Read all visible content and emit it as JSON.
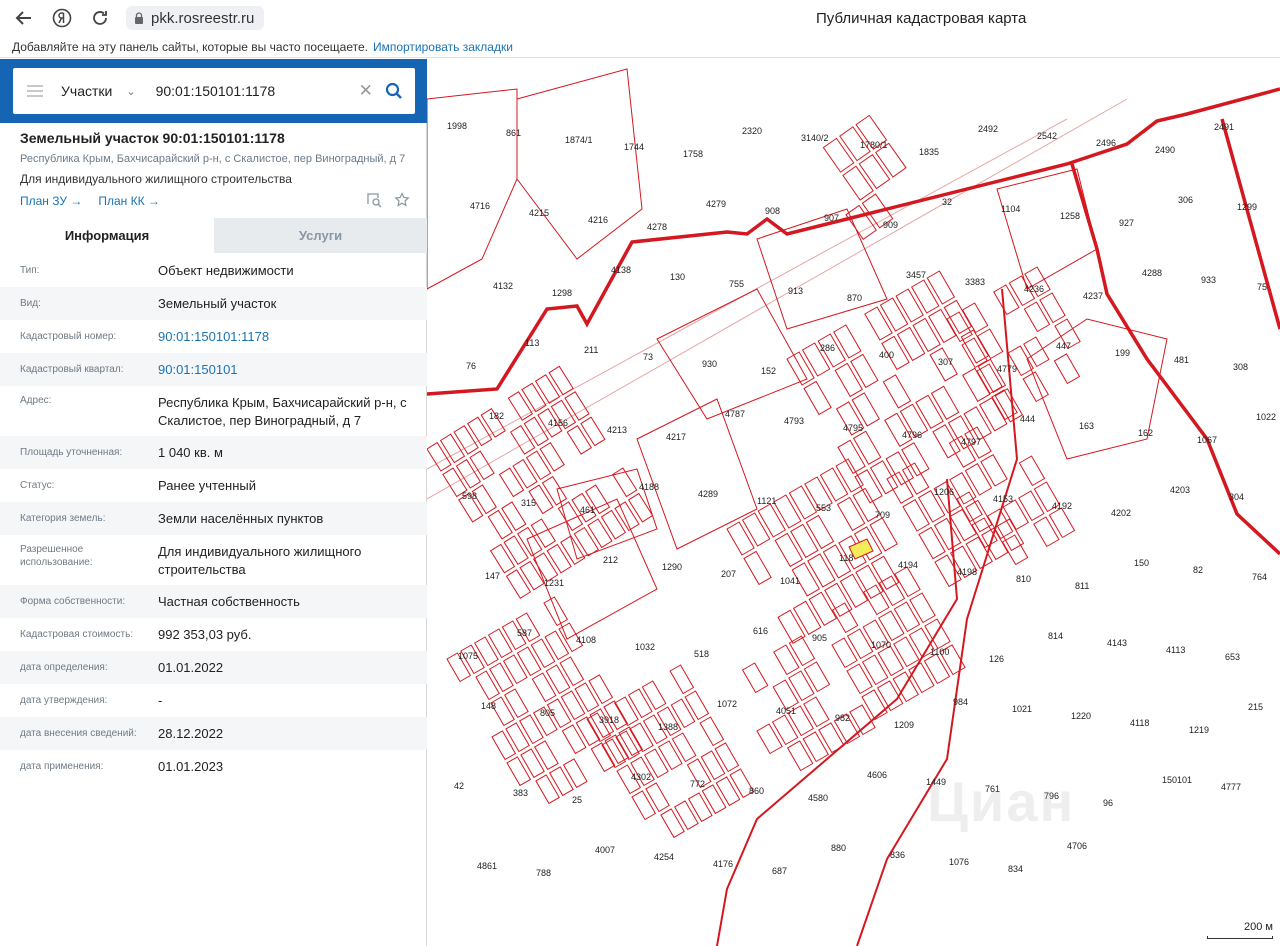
{
  "browser": {
    "url": "pkk.rosreestr.ru",
    "page_title": "Публичная кадастровая карта",
    "bookmarks_text": "Добавляйте на эту панель сайты, которые вы часто посещаете.",
    "import_link": "Импортировать закладки"
  },
  "search": {
    "layer": "Участки",
    "query": "90:01:150101:1178"
  },
  "object": {
    "title": "Земельный участок 90:01:150101:1178",
    "address": "Республика Крым, Бахчисарайский р-н, с Скалистое, пер Виноградный, д 7",
    "use": "Для индивидуального жилищного строительства",
    "plan_zu": "План ЗУ →",
    "plan_kk": "План КК →"
  },
  "tabs": {
    "info": "Информация",
    "services": "Услуги"
  },
  "rows": [
    {
      "key": "Тип:",
      "value": "Объект недвижимости"
    },
    {
      "key": "Вид:",
      "value": "Земельный участок"
    },
    {
      "key": "Кадастровый номер:",
      "value": "90:01:150101:1178"
    },
    {
      "key": "Кадастровый квартал:",
      "value": "90:01:150101"
    },
    {
      "key": "Адрес:",
      "value": "Республика Крым, Бахчисарайский р-н, с Скалистое, пер Виноградный, д 7"
    },
    {
      "key": "Площадь уточненная:",
      "value": "1 040 кв. м"
    },
    {
      "key": "Статус:",
      "value": "Ранее учтенный"
    },
    {
      "key": "Категория земель:",
      "value": "Земли населённых пунктов"
    },
    {
      "key": "Разрешенное использование:",
      "value": "Для индивидуального жилищного строительства"
    },
    {
      "key": "Форма собственности:",
      "value": "Частная собственность"
    },
    {
      "key": "Кадастровая стоимость:",
      "value": "992 353,03 руб."
    },
    {
      "key": "дата определения:",
      "value": "01.01.2022"
    },
    {
      "key": "дата утверждения:",
      "value": "-"
    },
    {
      "key": "дата внесения сведений:",
      "value": "28.12.2022"
    },
    {
      "key": "дата применения:",
      "value": "01.01.2023"
    }
  ],
  "map": {
    "watermark": "Циан",
    "scale": "200 м",
    "labels": [
      "1998",
      "861",
      "1874/1",
      "1744",
      "1758",
      "2320",
      "3140/2",
      "1780/1",
      "1835",
      "2492",
      "2542",
      "2496",
      "2490",
      "2491",
      "4716",
      "4215",
      "4216",
      "4278",
      "4279",
      "908",
      "907",
      "909",
      "32",
      "1104",
      "1258",
      "927",
      "306",
      "1299",
      "4132",
      "1298",
      "4138",
      "130",
      "755",
      "913",
      "870",
      "3457",
      "3383",
      "4236",
      "4237",
      "4288",
      "933",
      "75",
      "76",
      "113",
      "211",
      "73",
      "930",
      "152",
      "286",
      "400",
      "307",
      "4779",
      "447",
      "199",
      "481",
      "308",
      "182",
      "4156",
      "4213",
      "4217",
      "4787",
      "4793",
      "4795",
      "4796",
      "4797",
      "444",
      "163",
      "162",
      "1067",
      "1022",
      "598",
      "315",
      "461",
      "4188",
      "4289",
      "1121",
      "553",
      "709",
      "1206",
      "4153",
      "4192",
      "4202",
      "4203",
      "304",
      "147",
      "1231",
      "212",
      "1290",
      "207",
      "1041",
      "118",
      "4194",
      "4198",
      "810",
      "811",
      "150",
      "82",
      "764",
      "1075",
      "587",
      "4108",
      "1032",
      "518",
      "616",
      "905",
      "1070",
      "1100",
      "126",
      "814",
      "4143",
      "4113",
      "653",
      "148",
      "805",
      "3918",
      "1388",
      "1072",
      "4051",
      "982",
      "1209",
      "984",
      "1021",
      "1220",
      "4118",
      "1219",
      "215",
      "42",
      "383",
      "25",
      "4302",
      "772",
      "860",
      "4580",
      "4606",
      "1449",
      "761",
      "796",
      "96",
      "150101",
      "4777",
      "4861",
      "788",
      "4007",
      "4254",
      "4176",
      "687",
      "880",
      "836",
      "1076",
      "834",
      "4706"
    ]
  },
  "colors": {
    "accent": "#1565b4",
    "parcel": "#d4181f",
    "selected": "#f5ec5a"
  }
}
